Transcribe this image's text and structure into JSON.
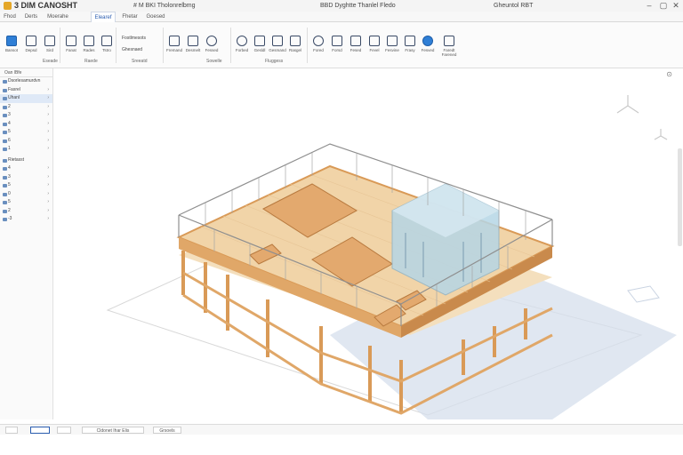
{
  "app": {
    "title": "3 DIM CANOSHT",
    "document_title": "# M BKI Tholonrelbmg",
    "document_subtitle": "BBD Dyghtte Thanlel Fledo",
    "window_info": "Gheuntol RBT"
  },
  "tabs": [
    {
      "label": "Fhod"
    },
    {
      "label": "Derts"
    },
    {
      "label": "Moerahe"
    },
    {
      "label": "Elearef",
      "active": true
    },
    {
      "label": "Fhetar"
    },
    {
      "label": "Goesed"
    }
  ],
  "ribbon": {
    "buttons": [
      {
        "label": "Bansot",
        "icon": "folder-icon",
        "style": "blue"
      },
      {
        "label": "Depsd",
        "icon": "document-icon"
      },
      {
        "label": "Sird",
        "icon": "tag-icon"
      },
      {
        "label": "Fanat",
        "icon": "scissors-icon"
      },
      {
        "label": "Rades",
        "icon": "layers-icon"
      },
      {
        "label": "Tstro",
        "icon": "wrench-icon"
      },
      {
        "label": "Fremand",
        "icon": "grid-icon"
      },
      {
        "label": "Desmelt",
        "icon": "pencil-icon"
      },
      {
        "label": "Fessed",
        "icon": "cylinder-icon",
        "style": "round"
      },
      {
        "label": "Forbed",
        "icon": "globe-icon",
        "style": "round"
      },
      {
        "label": "Gesldl",
        "icon": "image-icon"
      },
      {
        "label": "Gesmand",
        "icon": "monitor-icon"
      },
      {
        "label": "Rasgel",
        "icon": "brush-icon"
      },
      {
        "label": "Fored",
        "icon": "target-icon",
        "style": "round"
      },
      {
        "label": "Forsd",
        "icon": "truck-icon"
      },
      {
        "label": "Fesed",
        "icon": "chart-icon"
      },
      {
        "label": "Fevel",
        "icon": "page-icon"
      },
      {
        "label": "Fesvine",
        "icon": "window-icon"
      },
      {
        "label": "Frasy",
        "icon": "file-icon"
      },
      {
        "label": "Fesved",
        "icon": "blue-circle-icon",
        "style": "blue-round"
      },
      {
        "label": "Faredt Farened",
        "icon": "link-icon"
      }
    ],
    "list_items": [
      "Fostlmesots",
      "Ghesnaed"
    ],
    "groups": [
      "Eseade",
      "Raede",
      "Sreeatd",
      "Sowelle",
      "Fluggess"
    ]
  },
  "browser": {
    "header": "Oan  lBfe",
    "items": [
      {
        "label": "Dsorlesamurdvn",
        "selected": false
      },
      {
        "label": "Fasrel",
        "selected": false
      },
      {
        "label": "Uhanl",
        "selected": true
      },
      {
        "label": "2",
        "selected": false
      },
      {
        "label": "3",
        "selected": false
      },
      {
        "label": "4",
        "selected": false
      },
      {
        "label": "5",
        "selected": false
      },
      {
        "label": "6",
        "selected": false
      },
      {
        "label": "1",
        "selected": false
      },
      {
        "label": "Rietasst",
        "selected": false
      },
      {
        "label": "4",
        "selected": false
      },
      {
        "label": "3",
        "selected": false
      },
      {
        "label": "5",
        "selected": false
      },
      {
        "label": "0",
        "selected": false
      },
      {
        "label": "5",
        "selected": false
      },
      {
        "label": "2",
        "selected": false
      },
      {
        "label": "-3",
        "selected": false
      }
    ]
  },
  "statusbar": {
    "buttons": [
      "",
      "",
      "",
      "Cldonet Ihar Elis",
      "Grsoels"
    ]
  },
  "colors": {
    "wood": "#e0a768",
    "floor": "#f1d4a8",
    "glass": "#b6d6e6",
    "shadow": "#d5dfec",
    "rail": "#8f8f8f",
    "accent": "#2a5db0"
  }
}
